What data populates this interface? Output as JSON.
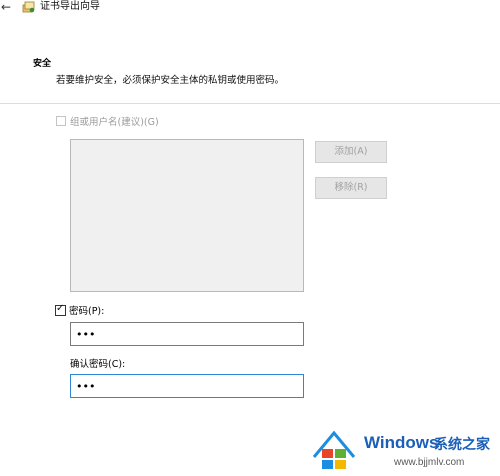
{
  "window": {
    "title": "证书导出向导",
    "back_icon": "arrow-left-icon",
    "wizard_icon": "certificate-wizard-icon"
  },
  "header": {
    "title": "安全",
    "description": "若要维护安全，必须保护安全主体的私钥或使用密码。"
  },
  "group_option": {
    "label": "组或用户名(建议)(G)",
    "checked": false,
    "enabled": false
  },
  "principals_list": {
    "items": [],
    "enabled": false
  },
  "buttons": {
    "add_label": "添加(A)",
    "remove_label": "移除(R)"
  },
  "password_option": {
    "label": "密码(P):",
    "checked": true,
    "value": "•••"
  },
  "confirm_password": {
    "label": "确认密码(C):",
    "value": "•••"
  },
  "watermark": {
    "brand": "Windows",
    "brand_suffix": "系统之家",
    "url": "www.bjjmlv.com",
    "colors": {
      "brand": "#1b5fb8",
      "logo_red": "#e8442a",
      "logo_green": "#5cb135",
      "logo_blue": "#1c8ee2",
      "logo_yellow": "#f5b800"
    }
  },
  "colors": {
    "focus_border": "#2f86d6",
    "disabled_text": "#9a9a9a",
    "disabled_button_bg": "#e6e6e6"
  }
}
